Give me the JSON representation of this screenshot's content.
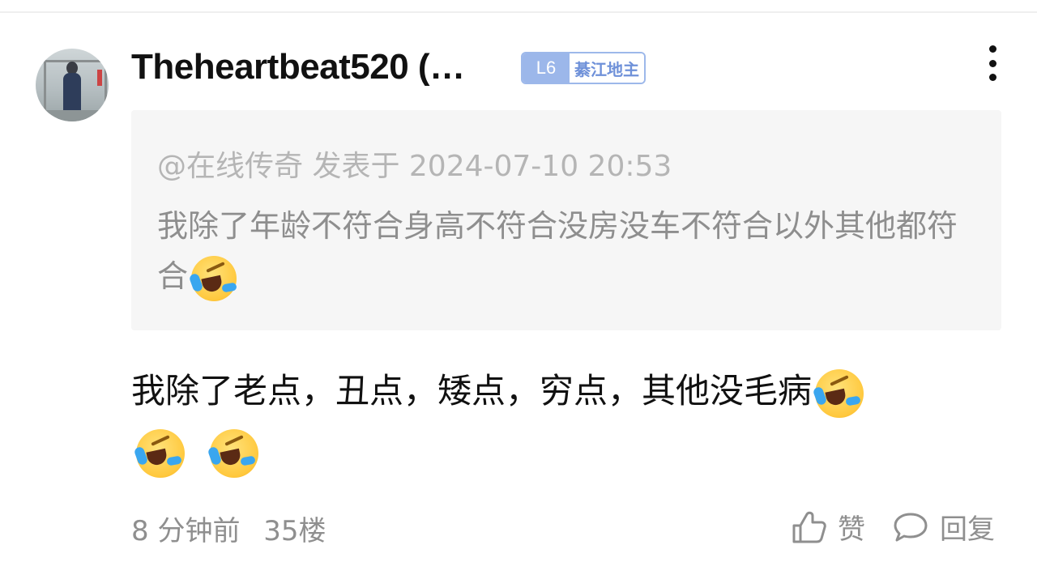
{
  "post": {
    "username": "Theheartbeat520 (…",
    "badge": {
      "level": "L6",
      "title": "綦江地主"
    },
    "quote": {
      "meta": "@在线传奇 发表于 2024-07-10 20:53",
      "text": "我除了年龄不符合身高不符合没房没车不符合以外其他都符合"
    },
    "body": "我除了老点，丑点，矮点，穷点，其他没毛病",
    "footer": {
      "time": "8 分钟前",
      "floor": "35楼"
    },
    "actions": {
      "like_label": "赞",
      "reply_label": "回复"
    },
    "icons": {
      "more": "more-vertical-icon",
      "emoji": "crying-laughing-emoji",
      "like": "thumbs-up-icon",
      "reply": "comment-bubble-icon"
    }
  }
}
